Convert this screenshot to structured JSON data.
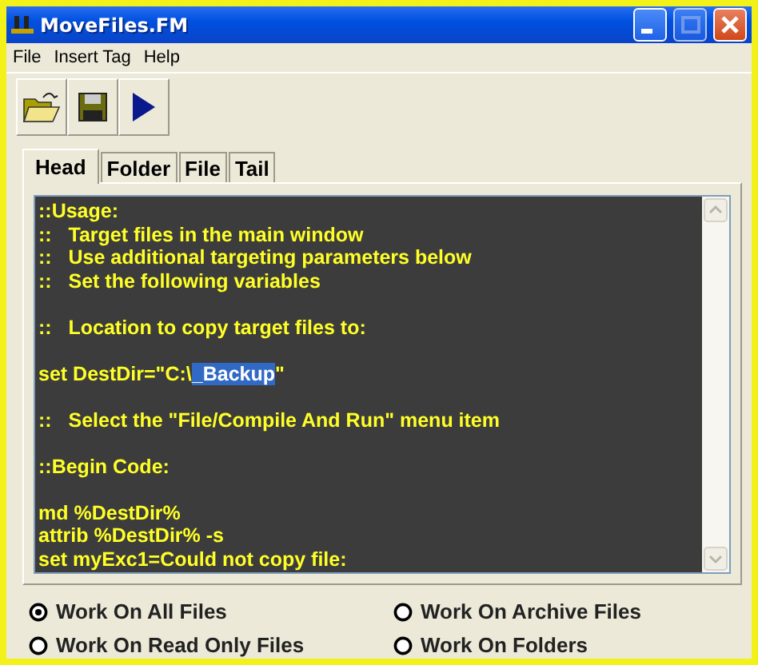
{
  "window": {
    "title": "MoveFiles.FM"
  },
  "menu": [
    "File",
    "Insert Tag",
    "Help"
  ],
  "toolbar": [
    {
      "kind": "open"
    },
    {
      "kind": "save"
    },
    {
      "kind": "run"
    }
  ],
  "tabs": [
    {
      "label": "Head",
      "selected": true
    },
    {
      "label": "Folder",
      "selected": false
    },
    {
      "label": "File",
      "selected": false
    },
    {
      "label": "Tail",
      "selected": false
    }
  ],
  "editor": {
    "paragraphs": [
      [
        {
          "text": "::Usage:"
        },
        {
          "text": "::   Target files in the main window"
        },
        {
          "text": "::   Use additional targeting parameters below"
        },
        {
          "text": "::   Set the following variables"
        }
      ],
      [
        {
          "text": "::   Location to copy target files to:"
        }
      ],
      [
        {
          "text": "set DestDir=\"C:\\",
          "selection": "_Backup",
          "after": "\""
        }
      ],
      [
        {
          "text": "::   Select the \"File/Compile And Run\" menu item"
        }
      ],
      [
        {
          "text": "::Begin Code:"
        }
      ],
      [
        {
          "text": "md %DestDir%"
        },
        {
          "text": "attrib %DestDir% -s"
        },
        {
          "text": "set myExc1=Could not copy file:"
        }
      ]
    ]
  },
  "options": [
    {
      "label": "Work On All Files",
      "selected": true
    },
    {
      "label": "Work On Archive Files",
      "selected": false
    },
    {
      "label": "Work On Read Only Files",
      "selected": false
    },
    {
      "label": "Work On Folders",
      "selected": false
    }
  ]
}
